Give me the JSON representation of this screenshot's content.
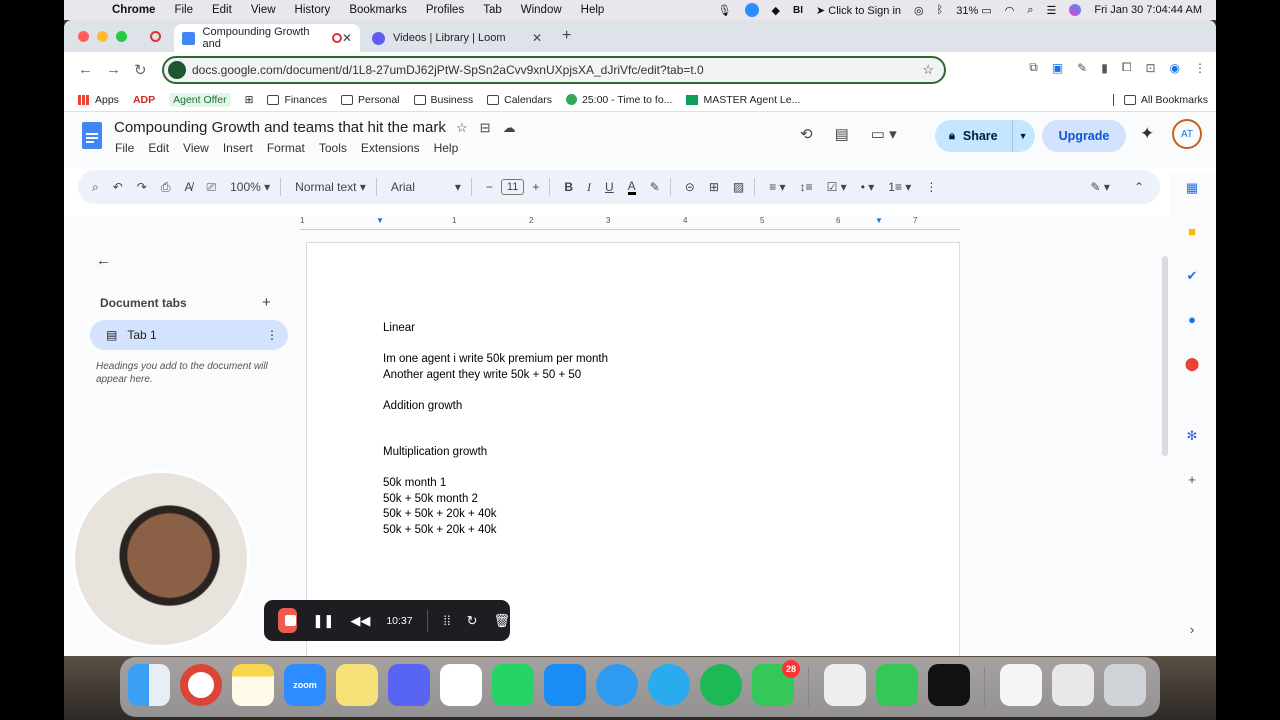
{
  "menubar": {
    "app": "Chrome",
    "items": [
      "File",
      "Edit",
      "View",
      "History",
      "Bookmarks",
      "Profiles",
      "Tab",
      "Window",
      "Help"
    ],
    "click_to_sign_in": "Click to Sign in",
    "battery": "31%",
    "datetime": "Fri Jan 30  7:04:44 AM"
  },
  "browser": {
    "tabs": [
      {
        "title": "Compounding Growth and",
        "active": true
      },
      {
        "title": "Videos | Library | Loom",
        "active": false
      }
    ],
    "url": "docs.google.com/document/d/1L8-27umDJ62jPtW-SpSn2aCvv9xnUXpjsXA_dJriVfc/edit?tab=t.0",
    "bookmarks": [
      "Apps",
      "ADP",
      "Agent Offer",
      "Finances",
      "Personal",
      "Business",
      "Calendars",
      "25:00 - Time to fo...",
      "MASTER Agent Le..."
    ],
    "all_bookmarks": "All Bookmarks"
  },
  "docs": {
    "title": "Compounding Growth and teams that hit the mark",
    "menus": [
      "File",
      "Edit",
      "View",
      "Insert",
      "Format",
      "Tools",
      "Extensions",
      "Help"
    ],
    "share_label": "Share",
    "upgrade_label": "Upgrade",
    "profile_initials": "AT",
    "toolbar": {
      "zoom": "100%",
      "style": "Normal text",
      "font": "Arial",
      "font_size": "11"
    },
    "ruler_labels": [
      "1",
      "1",
      "2",
      "3",
      "4",
      "5",
      "6",
      "7"
    ],
    "outline": {
      "header": "Document tabs",
      "tab_name": "Tab 1",
      "hint": "Headings you add to the document will appear here."
    },
    "body": {
      "p1": "Linear",
      "p2": "Im one agent i write 50k premium per month",
      "p3": "Another agent they write 50k + 50 + 50",
      "p4": "Addition growth",
      "p5": "Multiplication growth",
      "p6": "50k month 1",
      "p7": "50k + 50k month 2",
      "p8": "50k + 50k + 20k + 40k",
      "p9": "50k + 50k + 20k + 40k"
    }
  },
  "loom": {
    "timer": "10:37"
  },
  "dock": {
    "zoom_label": "zoom",
    "messages_badge": "28"
  }
}
